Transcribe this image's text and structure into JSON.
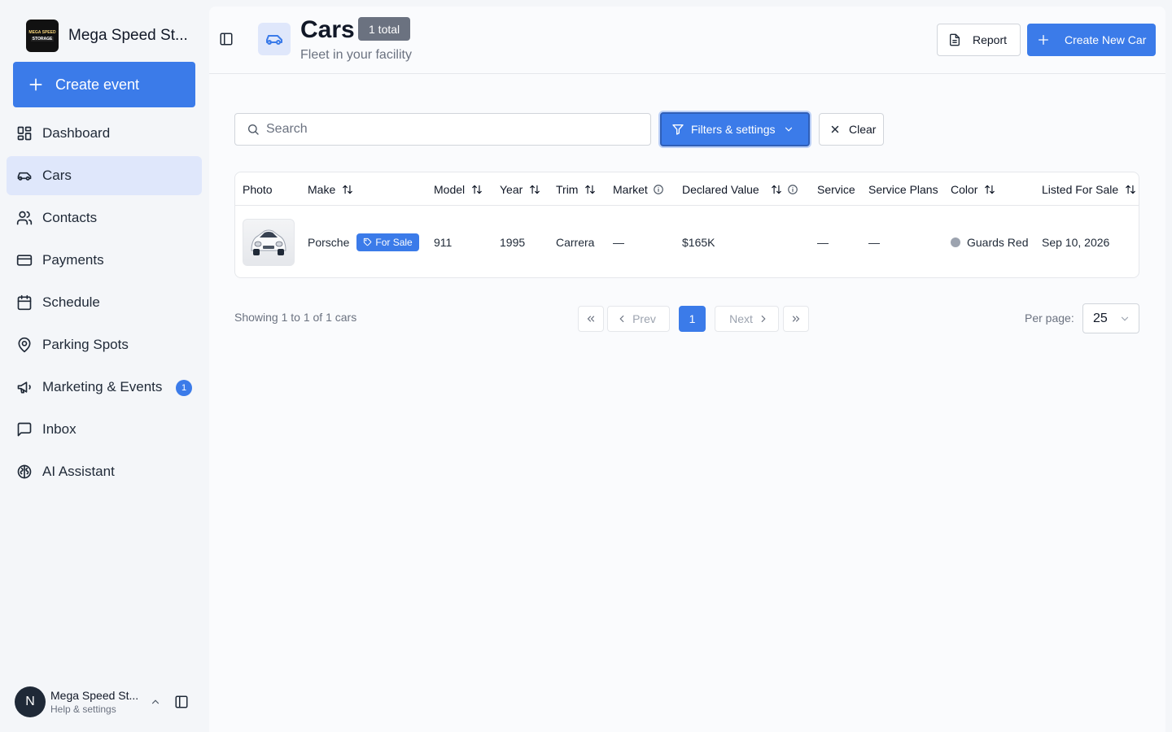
{
  "brand": {
    "logo_line1": "MEGA SPEED",
    "logo_line2": "STORAGE",
    "name": "Mega Speed St..."
  },
  "sidebar": {
    "create_event_label": "Create event",
    "items": [
      {
        "label": "Dashboard",
        "icon": "dashboard-icon"
      },
      {
        "label": "Cars",
        "icon": "car-icon",
        "active": true
      },
      {
        "label": "Contacts",
        "icon": "users-icon"
      },
      {
        "label": "Payments",
        "icon": "credit-card-icon"
      },
      {
        "label": "Schedule",
        "icon": "calendar-icon"
      },
      {
        "label": "Parking Spots",
        "icon": "map-pin-icon"
      },
      {
        "label": "Marketing & Events",
        "icon": "megaphone-icon",
        "badge": "1"
      },
      {
        "label": "Inbox",
        "icon": "message-square-icon"
      },
      {
        "label": "AI Assistant",
        "icon": "brain-icon"
      }
    ]
  },
  "user": {
    "initial": "N",
    "name": "Mega Speed St...",
    "subtitle": "Help & settings"
  },
  "header": {
    "title": "Cars",
    "total_badge": "1 total",
    "subtitle": "Fleet in your facility",
    "report_label": "Report",
    "create_label": "Create New Car"
  },
  "toolbar": {
    "search_placeholder": "Search",
    "filters_label": "Filters & settings",
    "clear_label": "Clear"
  },
  "table": {
    "columns": [
      "Photo",
      "Make",
      "Model",
      "Year",
      "Trim",
      "Market",
      "Declared Value",
      "Service",
      "Service Plans",
      "Color",
      "Listed For Sale"
    ],
    "rows": [
      {
        "make": "Porsche",
        "status_badge": "For Sale",
        "model": "911",
        "year": "1995",
        "trim": "Carrera",
        "market": "—",
        "declared_value": "$165K",
        "service": "—",
        "service_plans": "—",
        "color": "Guards Red",
        "listed_for_sale": "Sep 10, 2026"
      }
    ]
  },
  "pagination": {
    "showing": "Showing 1 to 1 of 1 cars",
    "prev_label": "Prev",
    "next_label": "Next",
    "current_page": "1",
    "per_page_label": "Per page:",
    "per_page_value": "25"
  },
  "colors": {
    "accent": "#3b7be9",
    "active_nav_bg": "#dfe7fb",
    "badge_gray": "#6b7280",
    "color_dot": "#9ca3af"
  }
}
